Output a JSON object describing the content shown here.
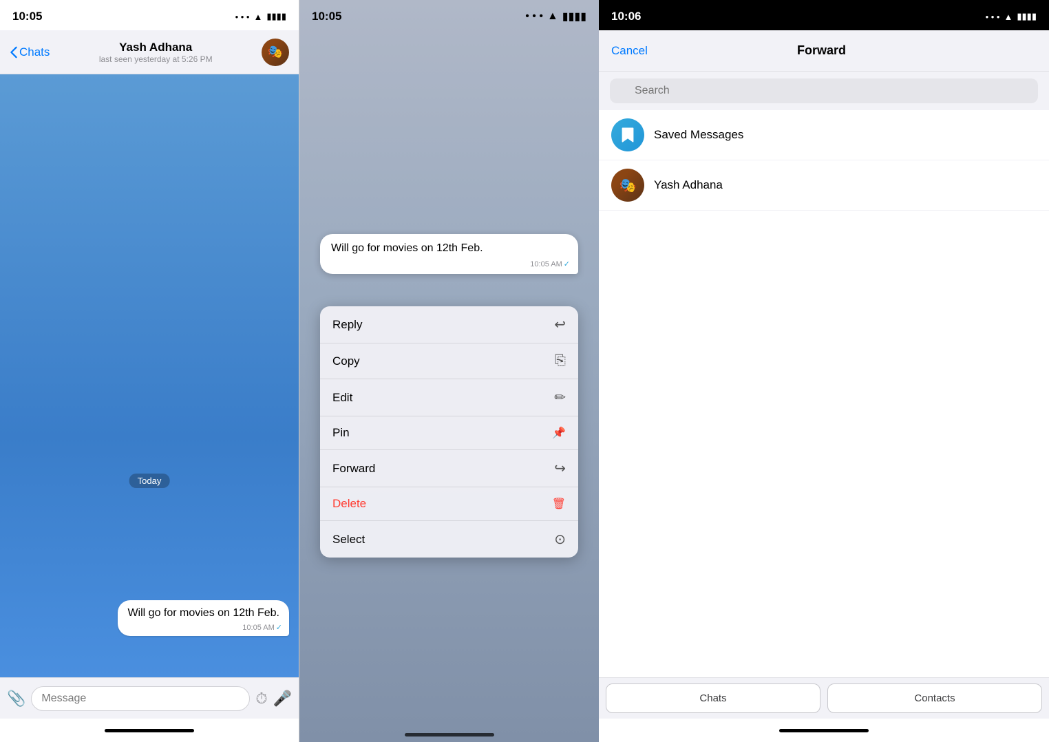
{
  "panel1": {
    "status_time": "10:05",
    "back_label": "Chats",
    "contact_name": "Yash Adhana",
    "contact_status": "last seen yesterday at 5:26 PM",
    "date_badge": "Today",
    "message_text": "Will go for movies on 12th Feb.",
    "message_time": "10:05 AM",
    "input_placeholder": "Message"
  },
  "panel2": {
    "status_time": "10:05",
    "message_text": "Will go for movies on 12th Feb.",
    "message_time": "10:05 AM",
    "menu_items": [
      {
        "label": "Reply",
        "icon": "↩",
        "color": "normal"
      },
      {
        "label": "Copy",
        "icon": "⎘",
        "color": "normal"
      },
      {
        "label": "Edit",
        "icon": "✏",
        "color": "normal"
      },
      {
        "label": "Pin",
        "icon": "📌",
        "color": "normal"
      },
      {
        "label": "Forward",
        "icon": "↪",
        "color": "normal"
      },
      {
        "label": "Delete",
        "icon": "🗑",
        "color": "delete"
      },
      {
        "label": "Select",
        "icon": "✓",
        "color": "normal"
      }
    ]
  },
  "panel3": {
    "status_time": "10:06",
    "cancel_label": "Cancel",
    "title": "Forward",
    "search_placeholder": "Search",
    "contacts": [
      {
        "name": "Saved Messages",
        "type": "saved"
      },
      {
        "name": "Yash Adhana",
        "type": "user"
      }
    ],
    "tab_chats": "Chats",
    "tab_contacts": "Contacts"
  }
}
